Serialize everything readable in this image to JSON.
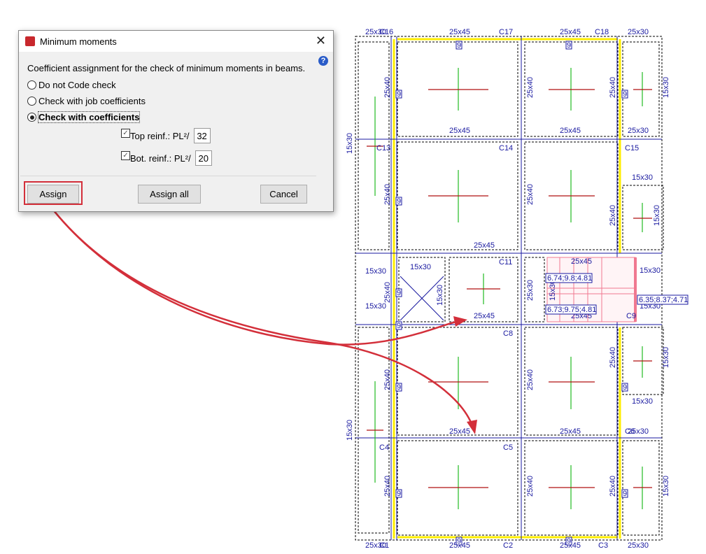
{
  "dialog": {
    "title": "Minimum moments",
    "close_icon": "close-icon",
    "help_icon": "?",
    "description": "Coefficient assignment for the check of minimum moments in beams.",
    "options": [
      {
        "label": "Do not Code check",
        "selected": false
      },
      {
        "label": "Check with job coefficients",
        "selected": false
      },
      {
        "label": "Check with coefficients",
        "selected": true
      }
    ],
    "top_reinf": {
      "label": "Top reinf.: PL²/",
      "checked": true,
      "value": "32"
    },
    "bot_reinf": {
      "label": "Bot. reinf.: PL²/",
      "checked": true,
      "value": "20"
    },
    "buttons": {
      "assign": "Assign",
      "assign_all": "Assign all",
      "cancel": "Cancel"
    }
  },
  "plan": {
    "labels": [
      "25x30",
      "C16",
      "25x45",
      "C17",
      "25x45",
      "C18",
      "25x30",
      "25x45",
      "25x45",
      "25x30",
      "C13",
      "C14",
      "C15",
      "15x30",
      "25x45",
      "C11",
      "15x30",
      "15x30",
      "15x30",
      "25x45",
      "25x45",
      "25x45",
      "15x30",
      "15x30",
      "C8",
      "C9",
      "25x45",
      "25x45",
      "25x30",
      "C4",
      "C5",
      "C6",
      "15x30",
      "25x30",
      "C1",
      "25x45",
      "C2",
      "25x45",
      "C3",
      "25x30"
    ],
    "vlabels": [
      "25x40",
      "25x40",
      "25x40",
      "15x30",
      "15x30",
      "25x40",
      "25x40",
      "25x40",
      "15x30",
      "25x40",
      "15x30",
      "25x30",
      "15x30",
      "25x40",
      "25x40",
      "25x40",
      "15x30",
      "15x30",
      "25x40",
      "25x40",
      "25x40",
      "15x30"
    ],
    "values": [
      "6.74;9.8;4.81",
      "6.73;9.75;4.81",
      "6.35;8.37;4.71"
    ],
    "marker": "9"
  },
  "colors": {
    "accent": "#d32f3a",
    "beam": "#1a1aa0",
    "yellow": "#ffee00"
  }
}
